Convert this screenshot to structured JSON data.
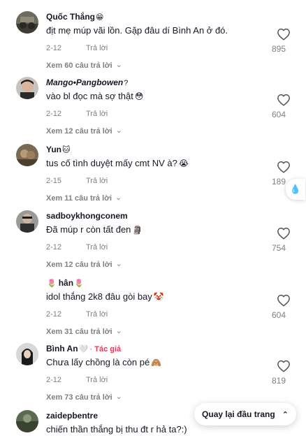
{
  "comments": [
    {
      "username": "Quốc Thắng",
      "name_emoji": "😁",
      "author_label": "",
      "text": "địt mẹ múp vãi lồn. Gặp đâu dí Bình An ở đó.",
      "text_emoji": "",
      "date": "2-12",
      "reply": "Trả lời",
      "likes": "895",
      "replies_label": "Xem 60 câu trả lời"
    },
    {
      "username": "Mango•Pangbowen",
      "name_emoji": "?",
      "author_label": "",
      "text": "vào bl đọc mà sợ thật",
      "text_emoji": "😳",
      "date": "2-12",
      "reply": "Trả lời",
      "likes": "604",
      "replies_label": "Xem 12 câu trả lời"
    },
    {
      "username": "Yun",
      "name_emoji": "🐱",
      "author_label": "",
      "text": "tus cố tình duyệt mấy cmt NV à?",
      "text_emoji": "😭",
      "date": "2-15",
      "reply": "Trả lời",
      "likes": "189",
      "replies_label": "Xem 11 câu trả lời"
    },
    {
      "username": "sadboykhongconem",
      "name_emoji": "",
      "author_label": "",
      "text": "Đã múp r còn tất đen",
      "text_emoji": "🗿",
      "date": "2-12",
      "reply": "Trả lời",
      "likes": "754",
      "replies_label": "Xem 12 câu trả lời"
    },
    {
      "username": "hân",
      "name_emoji": "🌷",
      "name_emoji_before": "🌷",
      "author_label": "",
      "text": "idol thắng 2k8 đâu gòi bay",
      "text_emoji": "🤡",
      "date": "2-12",
      "reply": "Trả lời",
      "likes": "604",
      "replies_label": "Xem 31 câu trả lời"
    },
    {
      "username": "Bình An",
      "name_emoji": "🤍",
      "author_label": "Tác giả",
      "text": "Chưa lấy chồng là còn pé",
      "text_emoji": "🙈",
      "date": "2-12",
      "reply": "Trả lời",
      "likes": "819",
      "replies_label": "Xem 73 câu trả lời"
    },
    {
      "username": "zaidepbentre",
      "name_emoji": "",
      "author_label": "",
      "text": "chiến thần thắng bị thu đt r hả ta?:)",
      "text_emoji": "",
      "date": "",
      "reply": "",
      "likes": "",
      "replies_label": ""
    }
  ],
  "back_to_top": "Quay lại đầu trang",
  "colors": {
    "text": "#161823",
    "secondary": "#7f7f86",
    "author": "#fe2c55"
  },
  "icons": {
    "like": "heart-outline-icon",
    "expand": "chevron-down-icon",
    "back_top": "chevron-up-icon",
    "side": "droplets-icon"
  }
}
